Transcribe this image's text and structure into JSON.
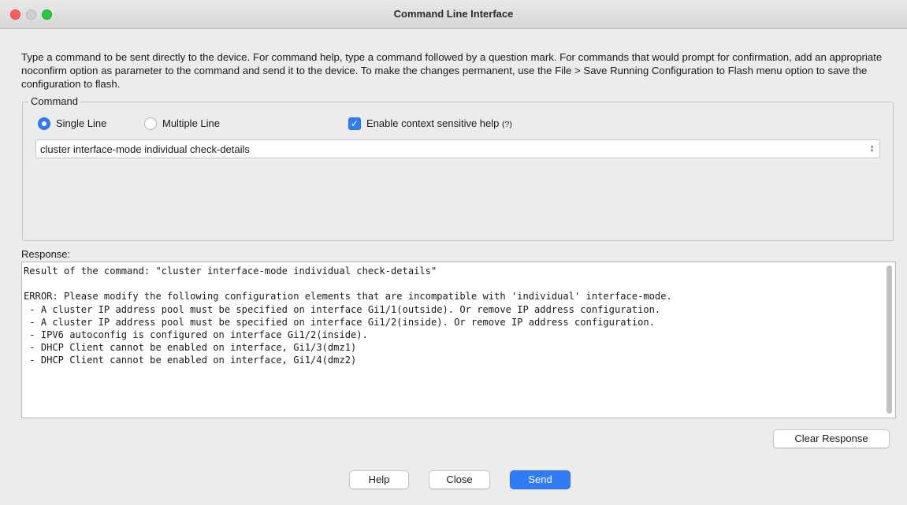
{
  "window": {
    "title": "Command Line Interface"
  },
  "intro": {
    "text": "Type a command to be sent directly to the device. For command help, type a command followed by a question mark. For commands that would prompt for confirmation, add an appropriate noconfirm option as parameter to the command and send it to the device. To make the changes permanent, use the File > Save Running Configuration to Flash menu option to save the configuration to flash."
  },
  "command": {
    "legend": "Command",
    "single_line_label": "Single Line",
    "multiple_line_label": "Multiple Line",
    "single_line_selected": true,
    "context_help_label": "Enable context sensitive help",
    "context_help_mark": "(?)",
    "context_help_checked": true,
    "value": "cluster interface-mode individual check-details"
  },
  "response": {
    "label": "Response:",
    "lines": [
      "Result of the command: \"cluster interface-mode individual check-details\"",
      "",
      "ERROR: Please modify the following configuration elements that are incompatible with 'individual' interface-mode.",
      " - A cluster IP address pool must be specified on interface Gi1/1(outside). Or remove IP address configuration.",
      " - A cluster IP address pool must be specified on interface Gi1/2(inside). Or remove IP address configuration.",
      " - IPV6 autoconfig is configured on interface Gi1/2(inside).",
      " - DHCP Client cannot be enabled on interface, Gi1/3(dmz1)",
      " - DHCP Client cannot be enabled on interface, Gi1/4(dmz2)"
    ]
  },
  "buttons": {
    "clear_response": "Clear Response",
    "help": "Help",
    "close": "Close",
    "send": "Send"
  },
  "colors": {
    "accent": "#2f7cf6",
    "traffic_close": "#fe5f57",
    "traffic_max": "#28c840"
  }
}
